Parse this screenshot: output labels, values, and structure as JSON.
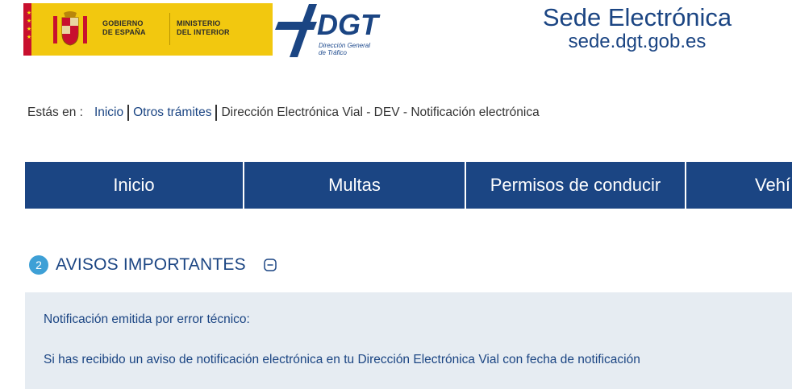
{
  "header": {
    "gov_line1a": "GOBIERNO",
    "gov_line1b": "DE ESPAÑA",
    "gov_line2a": "MINISTERIO",
    "gov_line2b": "DEL INTERIOR",
    "dgt_logo_text": "DGT",
    "dgt_sub1": "Dirección General",
    "dgt_sub2": "de Tráfico",
    "site_title": "Sede Electrónica",
    "site_url": "sede.dgt.gob.es"
  },
  "breadcrumb": {
    "label": "Estás en :",
    "items": [
      "Inicio",
      "Otros trámites",
      "Dirección Electrónica Vial - DEV - Notificación electrónica"
    ]
  },
  "nav": {
    "items": [
      "Inicio",
      "Multas",
      "Permisos de conducir",
      "Vehí"
    ]
  },
  "avisos": {
    "count": "2",
    "title": "AVISOS IMPORTANTES",
    "subtitle": "Notificación emitida por error técnico:",
    "text": "Si has recibido un aviso de notificación electrónica en tu Dirección Electrónica Vial con fecha de notificación"
  },
  "colors": {
    "brand_blue": "#1b4583",
    "gov_yellow": "#f2c80f",
    "badge_blue": "#3ea0d6",
    "notice_bg": "#e6ecf2"
  }
}
